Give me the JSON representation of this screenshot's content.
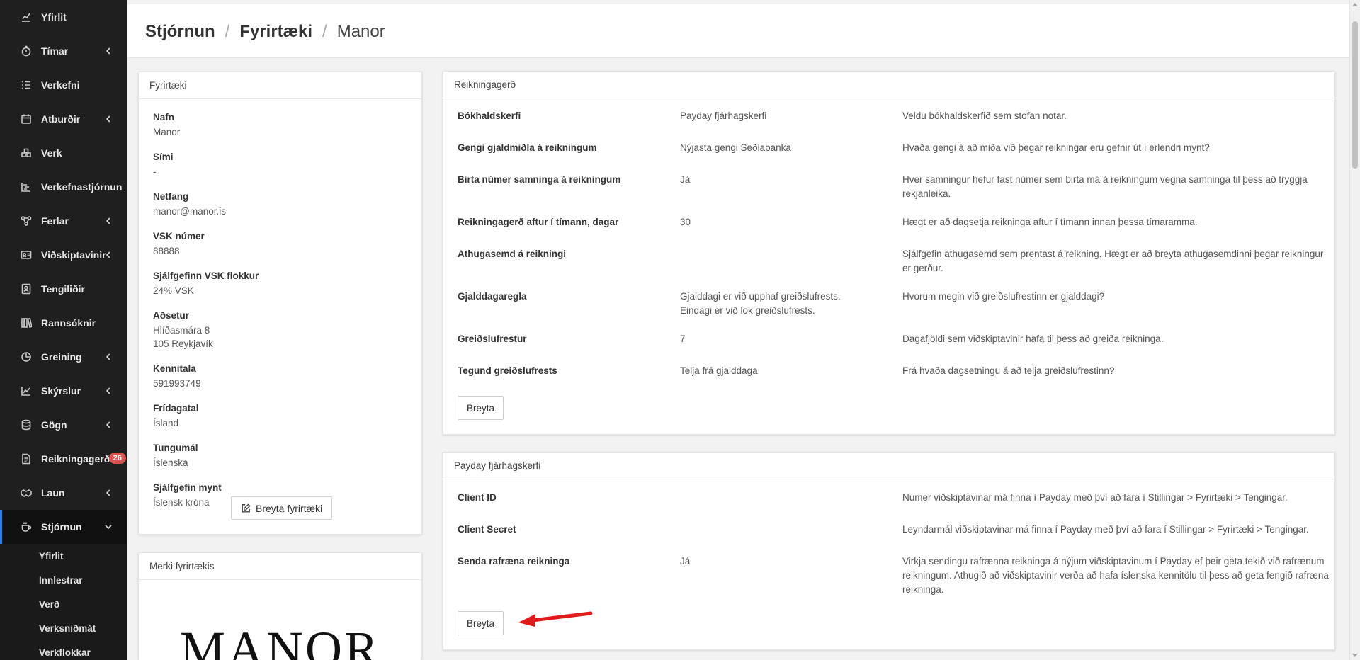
{
  "sidebar": {
    "items": [
      {
        "label": "Yfirlit",
        "icon": "chart-line-icon",
        "has_chevron": false
      },
      {
        "label": "Tímar",
        "icon": "stopwatch-icon",
        "has_chevron": true
      },
      {
        "label": "Verkefni",
        "icon": "tasks-list-icon",
        "has_chevron": false
      },
      {
        "label": "Atburðir",
        "icon": "calendar-icon",
        "has_chevron": true
      },
      {
        "label": "Verk",
        "icon": "boxes-icon",
        "has_chevron": false
      },
      {
        "label": "Verkefnastjórnun",
        "icon": "gantt-icon",
        "has_chevron": false
      },
      {
        "label": "Ferlar",
        "icon": "flow-icon",
        "has_chevron": true
      },
      {
        "label": "Viðskiptavinir",
        "icon": "id-card-icon",
        "has_chevron": true
      },
      {
        "label": "Tengiliðir",
        "icon": "contact-icon",
        "has_chevron": false
      },
      {
        "label": "Rannsóknir",
        "icon": "books-icon",
        "has_chevron": false
      },
      {
        "label": "Greining",
        "icon": "pie-chart-icon",
        "has_chevron": true
      },
      {
        "label": "Skýrslur",
        "icon": "line-chart-icon",
        "has_chevron": true
      },
      {
        "label": "Gögn",
        "icon": "database-icon",
        "has_chevron": true
      },
      {
        "label": "Reikningagerð",
        "icon": "invoice-icon",
        "has_chevron": false,
        "badge": "26"
      },
      {
        "label": "Laun",
        "icon": "handshake-icon",
        "has_chevron": true
      },
      {
        "label": "Stjórnun",
        "icon": "coffee-icon",
        "has_chevron": true,
        "active": true
      }
    ],
    "subitems": [
      "Yfirlit",
      "Innlestrar",
      "Verð",
      "Verksniðmát",
      "Verkflokkar"
    ],
    "badge_color": "#d9534f",
    "active_color": "#2b7de9"
  },
  "breadcrumb": {
    "level1": "Stjórnun",
    "level2": "Fyrirtæki",
    "current": "Manor",
    "separator": "/"
  },
  "company": {
    "header": "Fyrirtæki",
    "fields": [
      {
        "label": "Nafn",
        "value": "Manor"
      },
      {
        "label": "Sími",
        "value": "-"
      },
      {
        "label": "Netfang",
        "value": "manor@manor.is"
      },
      {
        "label": "VSK númer",
        "value": "88888"
      },
      {
        "label": "Sjálfgefinn VSK flokkur",
        "value": "24% VSK"
      },
      {
        "label": "Aðsetur",
        "value": "Hlíðasmára 8\n105 Reykjavík"
      },
      {
        "label": "Kennitala",
        "value": "591993749"
      },
      {
        "label": "Frídagatal",
        "value": "Ísland"
      },
      {
        "label": "Tungumál",
        "value": "Íslenska"
      },
      {
        "label": "Sjálfgefin mynt",
        "value": "Íslensk króna"
      }
    ],
    "edit_button": "Breyta fyrirtæki"
  },
  "logo_card": {
    "header": "Merki fyrirtækis",
    "logo_text": "MANOR"
  },
  "invoicing": {
    "header": "Reikningagerð",
    "rows": [
      {
        "label": "Bókhaldskerfi",
        "value": "Payday fjárhagskerfi",
        "desc": "Veldu bókhaldskerfið sem stofan notar."
      },
      {
        "label": "Gengi gjaldmiðla á reikningum",
        "value": "Nýjasta gengi Seðlabanka",
        "desc": "Hvaða gengi á að miða við þegar reikningar eru gefnir út í erlendri mynt?"
      },
      {
        "label": "Birta númer samninga á reikningum",
        "value": "Já",
        "desc": "Hver samningur hefur fast númer sem birta má á reikningum vegna samninga til þess að tryggja rekjanleika."
      },
      {
        "label": "Reikningagerð aftur í tímann, dagar",
        "value": "30",
        "desc": "Hægt er að dagsetja reikninga aftur í tímann innan þessa tímaramma."
      },
      {
        "label": "Athugasemd á reikningi",
        "value": "",
        "desc": "Sjálfgefin athugasemd sem prentast á reikning. Hægt er að breyta athugasemdinni þegar reikningur er gerður."
      },
      {
        "label": "Gjalddagaregla",
        "value": "Gjalddagi er við upphaf greiðslufrests.\nEindagi er við lok greiðslufrests.",
        "desc": "Hvorum megin við greiðslufrestinn er gjalddagi?"
      },
      {
        "label": "Greiðslufrestur",
        "value": "7",
        "desc": "Dagafjöldi sem viðskiptavinir hafa til þess að greiða reikninga."
      },
      {
        "label": "Tegund greiðslufrests",
        "value": "Telja frá gjalddaga",
        "desc": "Frá hvaða dagsetningu á að telja greiðslufrestinn?"
      }
    ],
    "edit_button": "Breyta"
  },
  "payday": {
    "header": "Payday fjárhagskerfi",
    "rows": [
      {
        "label": "Client ID",
        "value": "",
        "desc": "Númer viðskiptavinar má finna í Payday með því að fara í Stillingar > Fyrirtæki > Tengingar."
      },
      {
        "label": "Client Secret",
        "value": "",
        "desc": "Leyndarmál viðskiptavinar má finna í Payday með því að fara í Stillingar > Fyrirtæki > Tengingar."
      },
      {
        "label": "Senda rafræna reikninga",
        "value": "Já",
        "desc": "Virkja sendingu rafrænna reikninga á nýjum viðskiptavinum í Payday ef þeir geta tekið við rafrænum reikningum. Athugið að viðskiptavinir verða að hafa íslenska kennitölu til þess að geta fengið rafræna reikninga."
      }
    ],
    "edit_button": "Breyta",
    "annotation_arrow_color": "#e01b1b"
  }
}
